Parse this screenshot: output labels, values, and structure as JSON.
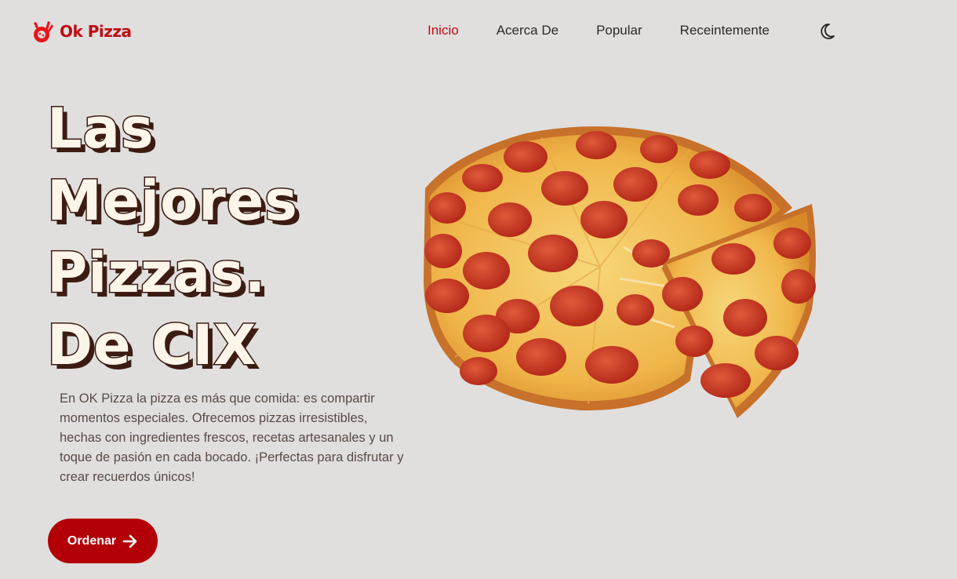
{
  "brand": {
    "name": "Ok Pizza",
    "color": "#bf0d12",
    "icon": "ok-hand-pizza-icon"
  },
  "nav": {
    "items": [
      {
        "label": "Inicio",
        "active": true
      },
      {
        "label": "Acerca De",
        "active": false
      },
      {
        "label": "Popular",
        "active": false
      },
      {
        "label": "Receintemente",
        "active": false
      }
    ],
    "theme_icon": "moon-icon"
  },
  "hero": {
    "title_lines": [
      "Las",
      "Mejores",
      "Pizzas.",
      "De CIX"
    ],
    "description": "En OK Pizza la pizza es más que comida: es compartir momentos especiales. Ofrecemos pizzas irresistibles, hechas con ingredientes frescos, recetas artesanales y un toque de pasión en cada bocado. ¡Perfectas para disfrutar y crear recuerdos únicos!",
    "cta_label": "Ordenar",
    "cta_icon": "arrow-right-icon",
    "image": "pepperoni-pizza-image"
  },
  "colors": {
    "background": "#e0dfde",
    "accent": "#b30008",
    "title_fill": "#fdf5ea",
    "title_stroke": "#3c1c12"
  }
}
